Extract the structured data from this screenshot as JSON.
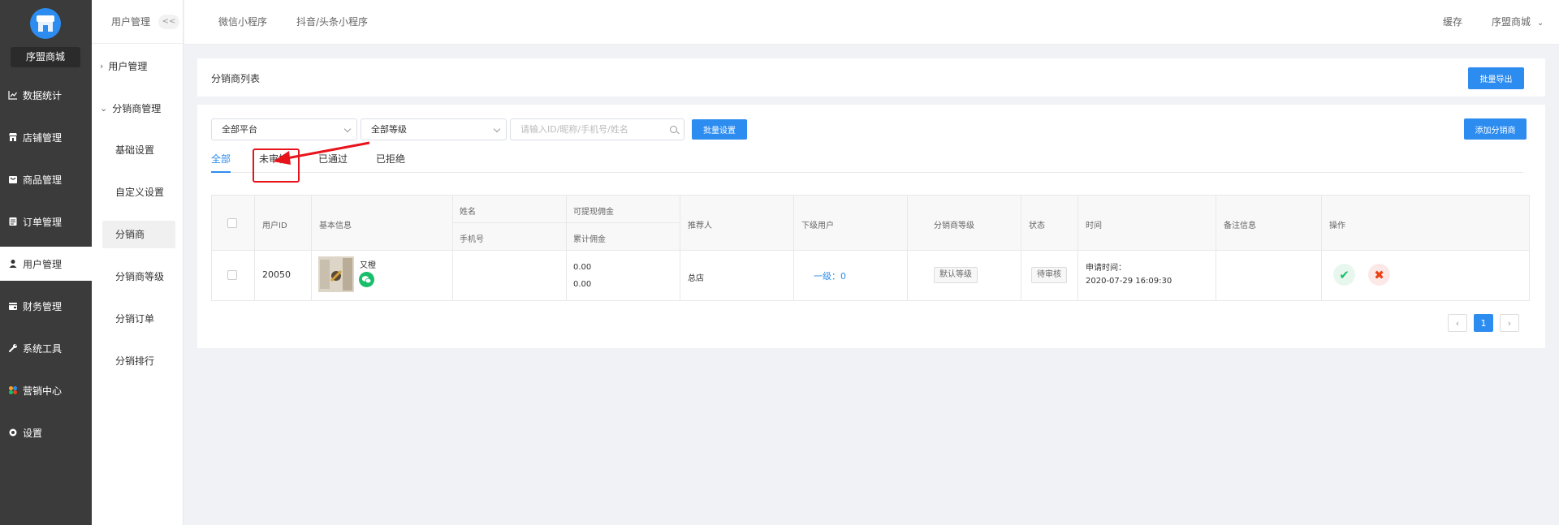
{
  "shop": {
    "name": "序盟商城"
  },
  "nav": [
    {
      "label": "数据统计",
      "icon": "chart-icon"
    },
    {
      "label": "店铺管理",
      "icon": "store-icon"
    },
    {
      "label": "商品管理",
      "icon": "goods-icon"
    },
    {
      "label": "订单管理",
      "icon": "order-icon"
    },
    {
      "label": "用户管理",
      "icon": "user-icon",
      "active": true
    },
    {
      "label": "财务管理",
      "icon": "finance-icon"
    },
    {
      "label": "系统工具",
      "icon": "wrench-icon"
    },
    {
      "label": "营销中心",
      "icon": "marketing-icon"
    },
    {
      "label": "设置",
      "icon": "gear-icon"
    }
  ],
  "subnav": {
    "head": "用户管理",
    "collapse": "<<",
    "groups": [
      "用户管理",
      "分销商管理"
    ],
    "items": [
      "基础设置",
      "自定义设置",
      "分销商",
      "分销商等级",
      "分销订单",
      "分销排行"
    ],
    "active": "分销商"
  },
  "topbar": {
    "tabs": [
      "微信小程序",
      "抖音/头条小程序"
    ],
    "cache": "缓存",
    "user": "序盟商城"
  },
  "page": {
    "title": "分销商列表",
    "export": "批量导出"
  },
  "filters": {
    "platform": "全部平台",
    "level": "全部等级",
    "search_placeholder": "请输入ID/昵称/手机号/姓名",
    "batch": "批量设置",
    "add": "添加分销商"
  },
  "tabs": [
    "全部",
    "未审核",
    "已通过",
    "已拒绝"
  ],
  "table": {
    "headers": {
      "id": "用户ID",
      "basic": "基本信息",
      "name": "姓名",
      "phone": "手机号",
      "withdrawable": "可提现佣金",
      "total": "累计佣金",
      "referrer": "推荐人",
      "downline": "下级用户",
      "level": "分销商等级",
      "status": "状态",
      "time": "时间",
      "remark": "备注信息",
      "action": "操作"
    },
    "rows": [
      {
        "id": "20050",
        "nickname": "又橙",
        "withdrawable": "0.00",
        "total": "0.00",
        "referrer": "总店",
        "downline": "一级：0",
        "level": "默认等级",
        "status": "待审核",
        "time_label": "申请时间：",
        "time": "2020-07-29 16:09:30"
      }
    ]
  },
  "pagination": {
    "current": "1"
  },
  "colors": {
    "accent": "#2d8cf0",
    "sidebar": "#3b3b3b",
    "highlight": "#e8141c"
  }
}
